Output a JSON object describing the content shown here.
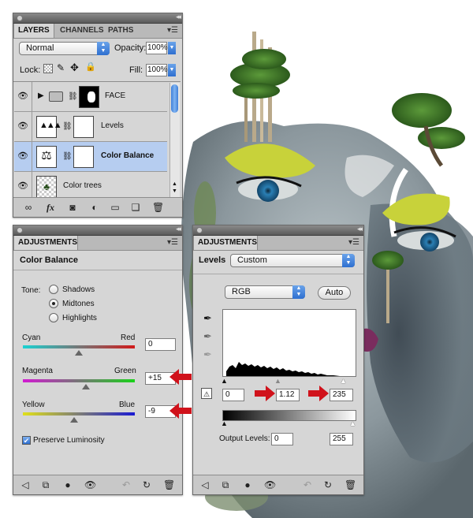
{
  "layers_panel": {
    "tabs": [
      "LAYERS",
      "CHANNELS",
      "PATHS"
    ],
    "blend_mode": "Normal",
    "opacity_label": "Opacity:",
    "opacity_value": "100%",
    "lock_label": "Lock:",
    "fill_label": "Fill:",
    "fill_value": "100%",
    "layers": [
      {
        "name": "FACE",
        "type": "group",
        "selected": false
      },
      {
        "name": "Levels",
        "type": "adjustment",
        "selected": false
      },
      {
        "name": "Color Balance",
        "type": "adjustment",
        "selected": true
      },
      {
        "name": "Color trees",
        "type": "pixel",
        "selected": false
      }
    ],
    "bottom_icons": [
      "link-icon",
      "fx-icon",
      "mask-icon",
      "adjustment-icon",
      "folder-icon",
      "new-layer-icon",
      "trash-icon"
    ],
    "fx_label": "fx"
  },
  "color_balance_panel": {
    "tab": "ADJUSTMENTS",
    "heading": "Color Balance",
    "tone_label": "Tone:",
    "tones": [
      {
        "label": "Shadows",
        "selected": false
      },
      {
        "label": "Midtones",
        "selected": true
      },
      {
        "label": "Highlights",
        "selected": false
      }
    ],
    "sliders": [
      {
        "left": "Cyan",
        "right": "Red",
        "value": "0",
        "position": 0.5
      },
      {
        "left": "Magenta",
        "right": "Green",
        "value": "+15",
        "position": 0.55
      },
      {
        "left": "Yellow",
        "right": "Blue",
        "value": "-9",
        "position": 0.46
      }
    ],
    "preserve_luminosity": "Preserve Luminosity",
    "preserve_checked": true
  },
  "levels_panel": {
    "tab": "ADJUSTMENTS",
    "heading": "Levels",
    "preset": "Custom",
    "channel": "RGB",
    "auto_label": "Auto",
    "input_black": "0",
    "input_gamma": "1.12",
    "input_white": "235",
    "output_label": "Output Levels:",
    "output_black": "0",
    "output_white": "255"
  },
  "colors": {
    "selection": "#b6cdf0",
    "accent_blue": "#2e6fd0",
    "annotation_red": "#d0121b",
    "panel_bg": "#d6d6d6"
  }
}
